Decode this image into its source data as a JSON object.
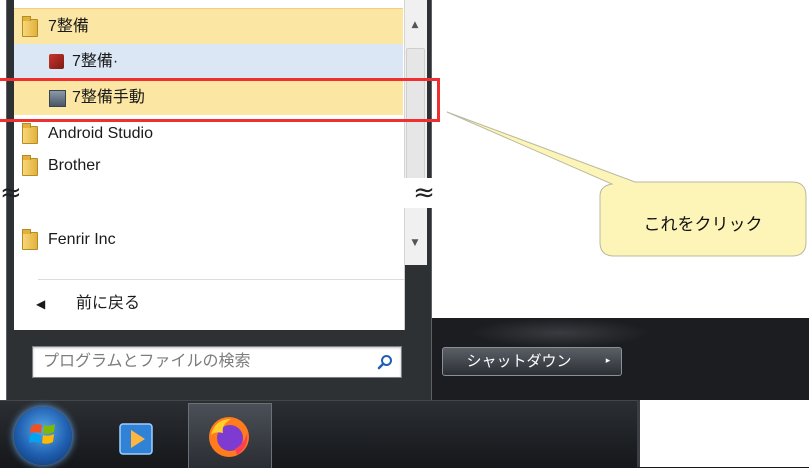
{
  "menu": {
    "programs": [
      {
        "label": "7整備",
        "icon": "folder-icon"
      },
      {
        "label": "7整備·",
        "icon": "app-icon"
      },
      {
        "label": "7整備手動",
        "icon": "app-icon"
      },
      {
        "label": "Android Studio",
        "icon": "folder-icon"
      },
      {
        "label": "Brother",
        "icon": "folder-icon"
      },
      {
        "label": "Fenrir Inc",
        "icon": "folder-icon"
      }
    ],
    "back_label": "前に戻る",
    "search_placeholder": "プログラムとファイルの検索",
    "break_mark": "≈"
  },
  "shutdown": {
    "label": "シャットダウン",
    "arrow": "▸"
  },
  "callout": {
    "text": "これをクリック"
  },
  "scroll": {
    "up": "▲",
    "down": "▼"
  },
  "colors": {
    "highlight": "#ee3030",
    "selected_row": "#fbe6a3",
    "hover_row": "#dbe7f5"
  }
}
